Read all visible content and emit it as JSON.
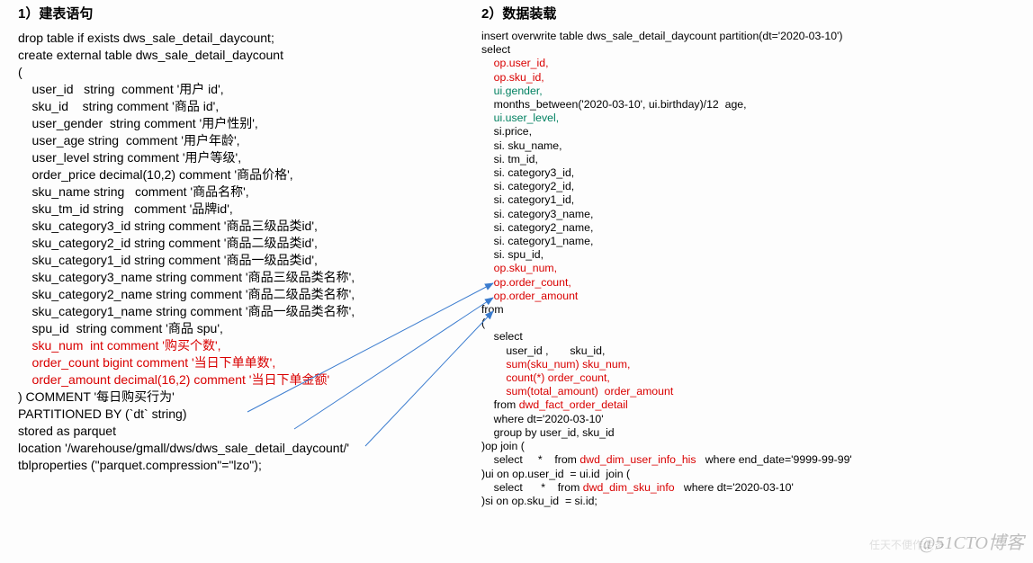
{
  "left": {
    "title": "1）建表语句",
    "lines": [
      {
        "t": "drop table if exists dws_sale_detail_daycount;"
      },
      {
        "t": "create external table dws_sale_detail_daycount"
      },
      {
        "t": "("
      },
      {
        "t": "    user_id   string  comment '用户 id',"
      },
      {
        "t": "    sku_id    string comment '商品 id',"
      },
      {
        "t": "    user_gender  string comment '用户性别',"
      },
      {
        "t": "    user_age string  comment '用户年龄',"
      },
      {
        "t": "    user_level string comment '用户等级',"
      },
      {
        "t": "    order_price decimal(10,2) comment '商品价格',"
      },
      {
        "t": "    sku_name string   comment '商品名称',"
      },
      {
        "t": "    sku_tm_id string   comment '品牌id',"
      },
      {
        "t": "    sku_category3_id string comment '商品三级品类id',"
      },
      {
        "t": "    sku_category2_id string comment '商品二级品类id',"
      },
      {
        "t": "    sku_category1_id string comment '商品一级品类id',"
      },
      {
        "t": "    sku_category3_name string comment '商品三级品类名称',"
      },
      {
        "t": "    sku_category2_name string comment '商品二级品类名称',"
      },
      {
        "t": "    sku_category1_name string comment '商品一级品类名称',"
      },
      {
        "t": "    spu_id  string comment '商品 spu',"
      },
      {
        "t": "    sku_num  int comment '购买个数',",
        "c": "red"
      },
      {
        "t": "    order_count bigint comment '当日下单单数',",
        "c": "red"
      },
      {
        "t": "    order_amount decimal(16,2) comment '当日下单金额'",
        "c": "red"
      },
      {
        "t": ") COMMENT '每日购买行为'"
      },
      {
        "t": "PARTITIONED BY (`dt` string)"
      },
      {
        "t": "stored as parquet"
      },
      {
        "t": "location '/warehouse/gmall/dws/dws_sale_detail_daycount/'"
      },
      {
        "t": "tblproperties (\"parquet.compression\"=\"lzo\");"
      }
    ]
  },
  "right": {
    "title": "2）数据装载",
    "lines": [
      {
        "t": "insert overwrite table dws_sale_detail_daycount partition(dt='2020-03-10')"
      },
      {
        "t": "select"
      },
      {
        "t": "    op.user_id,",
        "c": "red"
      },
      {
        "t": "    op.sku_id,",
        "c": "red"
      },
      {
        "t": "    ui.gender,",
        "c": "green"
      },
      {
        "t": "    months_between('2020-03-10', ui.birthday)/12  age,"
      },
      {
        "t": "    ui.user_level,",
        "c": "green"
      },
      {
        "t": "    si.price,"
      },
      {
        "t": "    si. sku_name,"
      },
      {
        "t": "    si. tm_id,"
      },
      {
        "t": "    si. category3_id,"
      },
      {
        "t": "    si. category2_id,"
      },
      {
        "t": "    si. category1_id,"
      },
      {
        "t": "    si. category3_name,"
      },
      {
        "t": "    si. category2_name,"
      },
      {
        "t": "    si. category1_name,"
      },
      {
        "t": "    si. spu_id,"
      },
      {
        "t": "    op.sku_num,",
        "c": "red"
      },
      {
        "t": "    op.order_count,",
        "c": "red"
      },
      {
        "t": "    op.order_amount",
        "c": "red"
      },
      {
        "t": "from"
      },
      {
        "t": "("
      },
      {
        "t": "    select"
      },
      {
        "t": "        user_id ,       sku_id,"
      },
      {
        "t": "        sum(sku_num) sku_num,",
        "c": "red"
      },
      {
        "t": "        count(*) order_count,",
        "c": "red"
      },
      {
        "t": "        sum(total_amount)  order_amount",
        "c": "red"
      },
      {
        "t": "    from dwd_fact_order_detail",
        "seg": [
          {
            "t": "    from "
          },
          {
            "t": "dwd_fact_order_detail",
            "c": "red"
          }
        ]
      },
      {
        "t": "    where dt='2020-03-10'"
      },
      {
        "t": "    group by user_id, sku_id"
      },
      {
        "t": ")op join ("
      },
      {
        "t": "    select     *    from dwd_dim_user_info_his   where end_date='9999-99-99'",
        "seg": [
          {
            "t": "    select     *    from "
          },
          {
            "t": "dwd_dim_user_info_his",
            "c": "red"
          },
          {
            "t": "   where end_date='9999-99-99'"
          }
        ]
      },
      {
        "t": ")ui on op.user_id  = ui.id  join ("
      },
      {
        "t": "    select      *    from dwd_dim_sku_info   where dt='2020-03-10'",
        "seg": [
          {
            "t": "    select      *    from "
          },
          {
            "t": "dwd_dim_sku_info",
            "c": "red"
          },
          {
            "t": "   where dt='2020-03-10'"
          }
        ]
      },
      {
        "t": ")si on op.sku_id  = si.id;"
      }
    ]
  },
  "watermark": "@51CTO博客",
  "watermark2": "任天不便作使多"
}
